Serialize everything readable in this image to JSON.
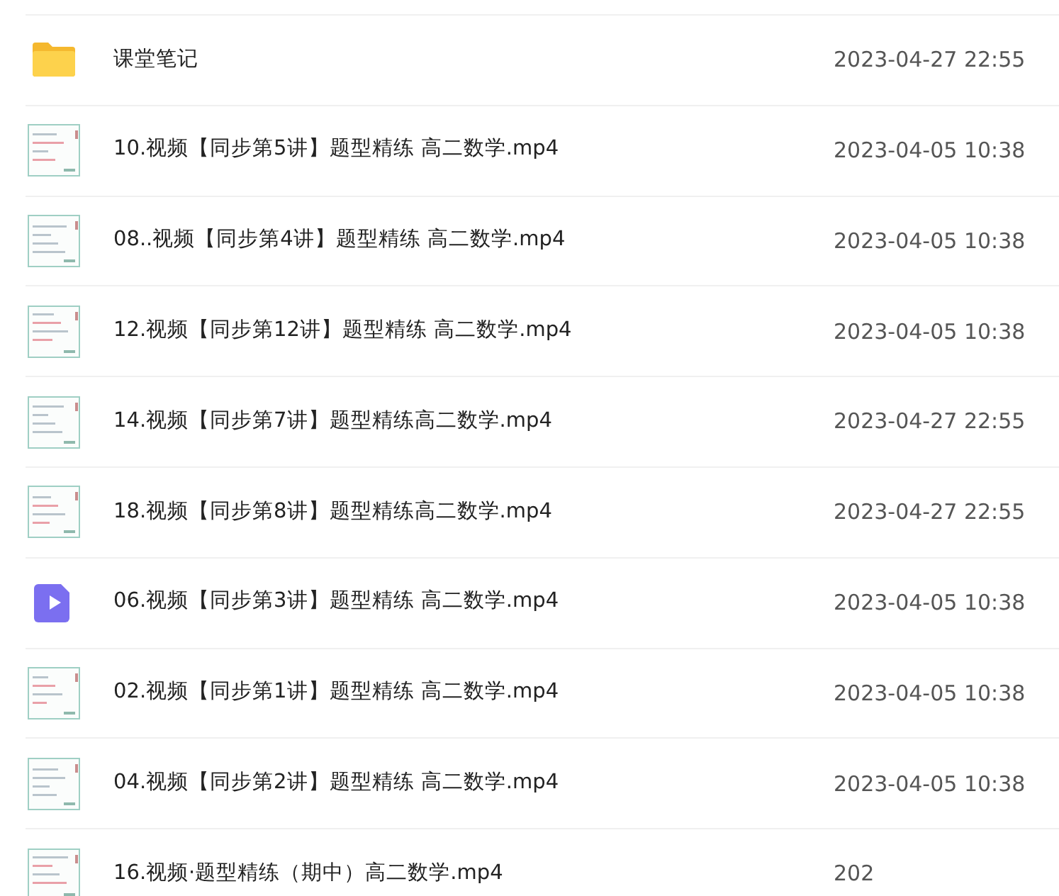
{
  "files": [
    {
      "kind": "folder",
      "name": "课堂笔记",
      "date": "2023-04-27 22:55"
    },
    {
      "kind": "thumbnail",
      "name": "10.视频【同步第5讲】题型精练 高二数学.mp4",
      "date": "2023-04-05 10:38"
    },
    {
      "kind": "thumbnail",
      "name": "08..视频【同步第4讲】题型精练 高二数学.mp4",
      "date": "2023-04-05 10:38"
    },
    {
      "kind": "thumbnail",
      "name": "12.视频【同步第12讲】题型精练 高二数学.mp4",
      "date": "2023-04-05 10:38"
    },
    {
      "kind": "thumbnail",
      "name": "14.视频【同步第7讲】题型精练高二数学.mp4",
      "date": "2023-04-27 22:55"
    },
    {
      "kind": "thumbnail",
      "name": "18.视频【同步第8讲】题型精练高二数学.mp4",
      "date": "2023-04-27 22:55"
    },
    {
      "kind": "video",
      "name": "06.视频【同步第3讲】题型精练 高二数学.mp4",
      "date": "2023-04-05 10:38"
    },
    {
      "kind": "thumbnail",
      "name": "02.视频【同步第1讲】题型精练 高二数学.mp4",
      "date": "2023-04-05 10:38"
    },
    {
      "kind": "thumbnail",
      "name": "04.视频【同步第2讲】题型精练 高二数学.mp4",
      "date": "2023-04-05 10:38"
    },
    {
      "kind": "thumbnail",
      "name": "16.视频·题型精练（期中）高二数学.mp4",
      "date": "202"
    }
  ]
}
